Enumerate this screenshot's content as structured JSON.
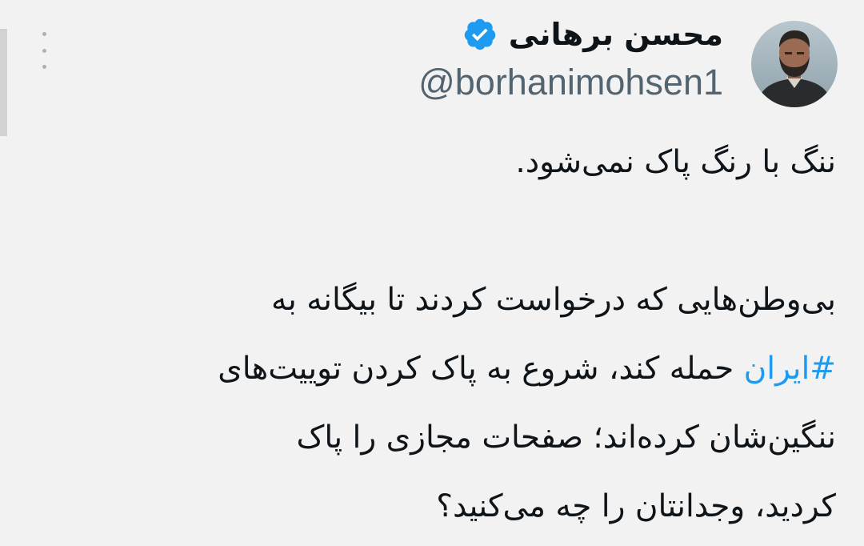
{
  "tweet": {
    "author": {
      "display_name": "محسن برهانی",
      "handle": "@borhanimohsen1",
      "verified": true,
      "verified_color": "#1d9bf0",
      "avatar_icon": "profile-photo"
    },
    "more_icon": "vertical-ellipsis-icon",
    "text": {
      "line1": "ننگ با رنگ پاک نمی‌شود.",
      "line2": "بی‌وطن‌هایی که درخواست کردند تا بیگانه به",
      "hashtag": "#ایران",
      "line3_rest": " حمله کند، شروع به پاک کردن توییت‌های",
      "line4": "ننگین‌شان کرده‌اند؛ صفحات مجازی را پاک",
      "line5": "کردید، وجدانتان را چه می‌کنید؟"
    },
    "colors": {
      "text": "#0f1419",
      "secondary": "#536471",
      "link": "#1d9bf0",
      "background": "#f2f2f2"
    }
  }
}
